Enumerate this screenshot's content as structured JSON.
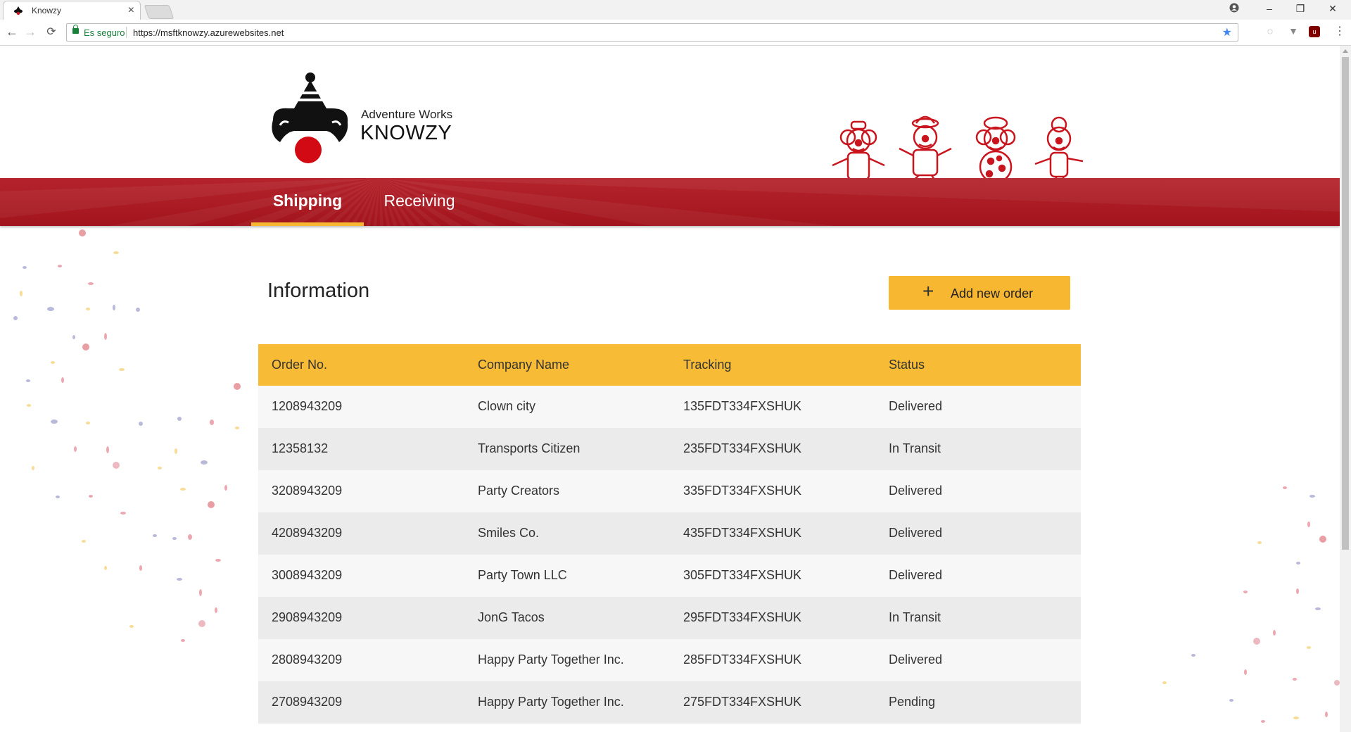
{
  "browser": {
    "tab_title": "Knowzy",
    "secure_label": "Es seguro",
    "url": "https://msftknowzy.azurewebsites.net"
  },
  "header": {
    "brand_sub": "Adventure Works",
    "brand_main": "KNOWZY"
  },
  "nav": {
    "tabs": [
      {
        "label": "Shipping",
        "active": true
      },
      {
        "label": "Receiving",
        "active": false
      }
    ]
  },
  "main": {
    "title": "Information",
    "add_button_label": "Add new order",
    "table": {
      "headers": [
        "Order No.",
        "Company Name",
        "Tracking",
        "Status"
      ],
      "rows": [
        [
          "1208943209",
          "Clown city",
          "135FDT334FXSHUK",
          "Delivered"
        ],
        [
          "12358132",
          "Transports Citizen",
          "235FDT334FXSHUK",
          "In Transit"
        ],
        [
          "3208943209",
          "Party Creators",
          "335FDT334FXSHUK",
          "Delivered"
        ],
        [
          "4208943209",
          "Smiles Co.",
          "435FDT334FXSHUK",
          "Delivered"
        ],
        [
          "3008943209",
          "Party Town LLC",
          "305FDT334FXSHUK",
          "Delivered"
        ],
        [
          "2908943209",
          "JonG Tacos",
          "295FDT334FXSHUK",
          "In Transit"
        ],
        [
          "2808943209",
          "Happy Party Together Inc.",
          "285FDT334FXSHUK",
          "Delivered"
        ],
        [
          "2708943209",
          "Happy Party Together Inc.",
          "275FDT334FXSHUK",
          "Pending"
        ]
      ]
    }
  },
  "colors": {
    "nav_red": "#b0161f",
    "accent_yellow": "#f7b731",
    "header_yellow": "#f7bb35",
    "clown_red": "#c8151e"
  }
}
